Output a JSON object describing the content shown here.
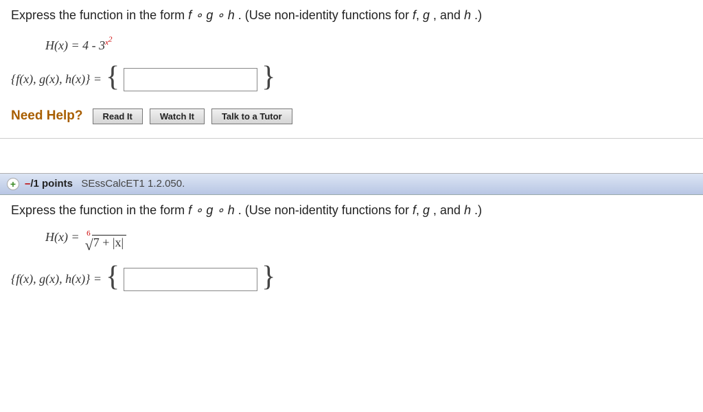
{
  "q1": {
    "prompt_prefix": "Express the function in the form ",
    "prompt_comp": "f ∘ g ∘ h",
    "prompt_suffix": ". (Use non-identity functions for ",
    "prompt_suffix2": ", and ",
    "prompt_end": ".)",
    "fn_lhs": "H(x) = 4 - 3",
    "exp_base": "x",
    "exp_top": "2",
    "answer_label": "{f(x), g(x), h(x)} = ",
    "input_value": "",
    "help_label": "Need Help?",
    "buttons": {
      "read": "Read It",
      "watch": "Watch It",
      "tutor": "Talk to a Tutor"
    }
  },
  "header2": {
    "dash": "–",
    "points": "/1 points",
    "source": "SEssCalcET1 1.2.050."
  },
  "q2": {
    "prompt_prefix": "Express the function in the form ",
    "prompt_comp": "f ∘ g ∘ h",
    "prompt_suffix": ". (Use non-identity functions for ",
    "prompt_suffix2": ", and ",
    "prompt_end": ".)",
    "fn_lhs": "H(x) = ",
    "rad_index": "6",
    "radicand": "7 + |x|",
    "answer_label": "{f(x), g(x), h(x)} = ",
    "input_value": ""
  },
  "letters": {
    "f": "f",
    "g": "g",
    "h": "h"
  }
}
